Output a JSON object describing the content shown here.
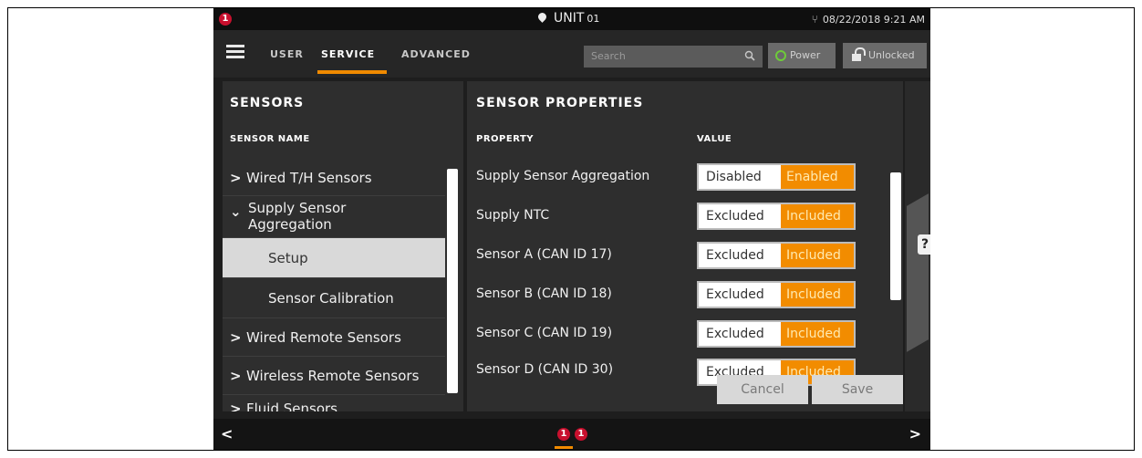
{
  "status_bar": {
    "alert_count": "1",
    "unit_label": "UNIT",
    "unit_number": "01",
    "datetime": "08/22/2018 9:21 AM",
    "icons": [
      "alert-icon",
      "location-pin-icon",
      "usb-icon"
    ]
  },
  "nav": {
    "tabs": [
      {
        "label": "USER",
        "active": false
      },
      {
        "label": "SERVICE",
        "active": true
      },
      {
        "label": "ADVANCED",
        "active": false
      }
    ],
    "search_placeholder": "Search",
    "power_label": "Power",
    "lock_label": "Unlocked",
    "accent_color": "#f08a00"
  },
  "sensors": {
    "title": "SENSORS",
    "column_header": "SENSOR NAME",
    "items": [
      {
        "label": "Wired T/H Sensors",
        "chevron": "right"
      },
      {
        "label": "Supply Sensor Aggregation",
        "chevron": "down"
      },
      {
        "label": "Setup",
        "selected": true
      },
      {
        "label": "Sensor Calibration"
      },
      {
        "label": "Wired Remote Sensors",
        "chevron": "right"
      },
      {
        "label": "Wireless Remote Sensors",
        "chevron": "right"
      },
      {
        "label": "Fluid Sensors",
        "chevron": "right"
      }
    ]
  },
  "properties": {
    "title": "SENSOR PROPERTIES",
    "col_property": "PROPERTY",
    "col_value": "VALUE",
    "rows": [
      {
        "name": "Supply Sensor Aggregation",
        "off": "Disabled",
        "on": "Enabled",
        "selected": "on"
      },
      {
        "name": "Supply NTC",
        "off": "Excluded",
        "on": "Included",
        "selected": "on"
      },
      {
        "name": "Sensor A (CAN ID 17)",
        "off": "Excluded",
        "on": "Included",
        "selected": "on"
      },
      {
        "name": "Sensor B (CAN ID 18)",
        "off": "Excluded",
        "on": "Included",
        "selected": "on"
      },
      {
        "name": "Sensor C (CAN ID 19)",
        "off": "Excluded",
        "on": "Included",
        "selected": "on"
      },
      {
        "name": "Sensor D (CAN ID 30)",
        "off": "Excluded",
        "on": "Included",
        "selected": "on"
      }
    ],
    "cancel_label": "Cancel",
    "save_label": "Save",
    "help_label": "?"
  },
  "bottom_bar": {
    "prev_label": "<",
    "next_label": ">",
    "alerts": [
      "1",
      "1"
    ]
  }
}
